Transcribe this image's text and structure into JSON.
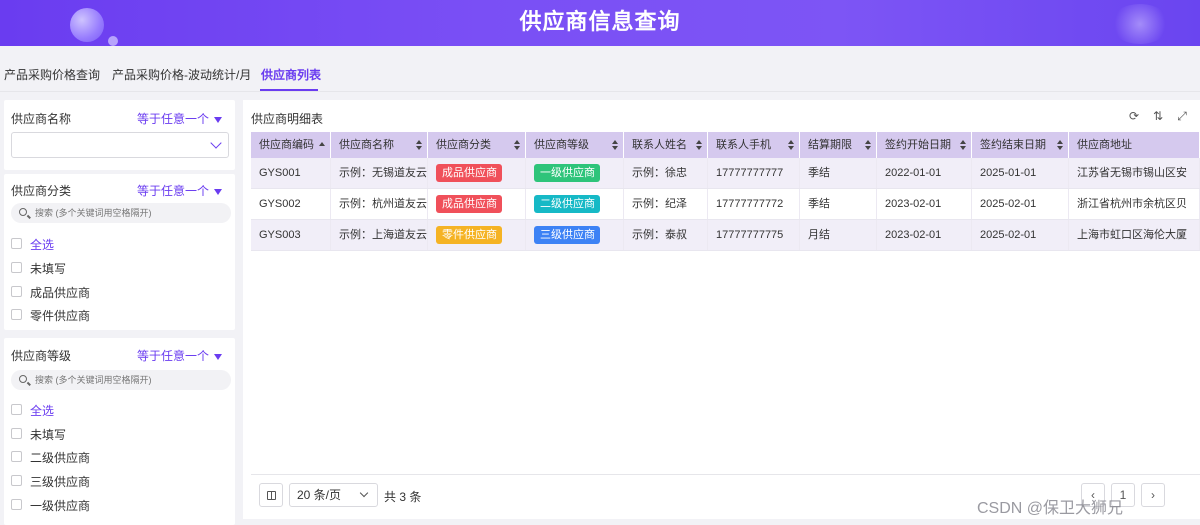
{
  "header": {
    "title": "供应商信息查询"
  },
  "tabs": [
    {
      "label": "产品采购价格查询",
      "active": false
    },
    {
      "label": "产品采购价格-波动统计/月",
      "active": false
    },
    {
      "label": "供应商列表",
      "active": true
    }
  ],
  "filters": {
    "name": {
      "label": "供应商名称",
      "operator": "等于任意一个"
    },
    "category": {
      "label": "供应商分类",
      "operator": "等于任意一个",
      "search_placeholder": "搜索 (多个关键词用空格隔开)",
      "options": [
        "全选",
        "未填写",
        "成品供应商",
        "零件供应商"
      ]
    },
    "level": {
      "label": "供应商等级",
      "operator": "等于任意一个",
      "search_placeholder": "搜索 (多个关键词用空格隔开)",
      "options": [
        "全选",
        "未填写",
        "二级供应商",
        "三级供应商",
        "一级供应商"
      ]
    }
  },
  "table": {
    "title": "供应商明细表",
    "columns": [
      "供应商编码",
      "供应商名称",
      "供应商分类",
      "供应商等级",
      "联系人姓名",
      "联系人手机",
      "结算期限",
      "签约开始日期",
      "签约结束日期",
      "供应商地址"
    ],
    "rows": [
      {
        "code": "GYS001",
        "name": "示例：无锡道友云",
        "category": "成品供应商",
        "level": "一级供应商",
        "contact": "示例：徐忠",
        "phone": "17777777777",
        "term": "季结",
        "start": "2022-01-01",
        "end": "2025-01-01",
        "address": "江苏省无锡市锡山区安"
      },
      {
        "code": "GYS002",
        "name": "示例：杭州道友云",
        "category": "成品供应商",
        "level": "二级供应商",
        "contact": "示例：纪泽",
        "phone": "17777777772",
        "term": "季结",
        "start": "2023-02-01",
        "end": "2025-02-01",
        "address": "浙江省杭州市余杭区贝"
      },
      {
        "code": "GYS003",
        "name": "示例：上海道友云",
        "category": "零件供应商",
        "level": "三级供应商",
        "contact": "示例：泰叔",
        "phone": "17777777775",
        "term": "月结",
        "start": "2023-02-01",
        "end": "2025-02-01",
        "address": "上海市虹口区海伦大厦"
      }
    ],
    "tag_colors": {
      "成品供应商": "#f0505a",
      "零件供应商": "#f5b324",
      "一级供应商": "#2ec47a",
      "二级供应商": "#16b9c6",
      "三级供应商": "#3d82f5"
    }
  },
  "pagination": {
    "page_size": "20 条/页",
    "total": "共 3 条",
    "current_page": "1"
  },
  "watermark": "CSDN @保卫大狮兄"
}
